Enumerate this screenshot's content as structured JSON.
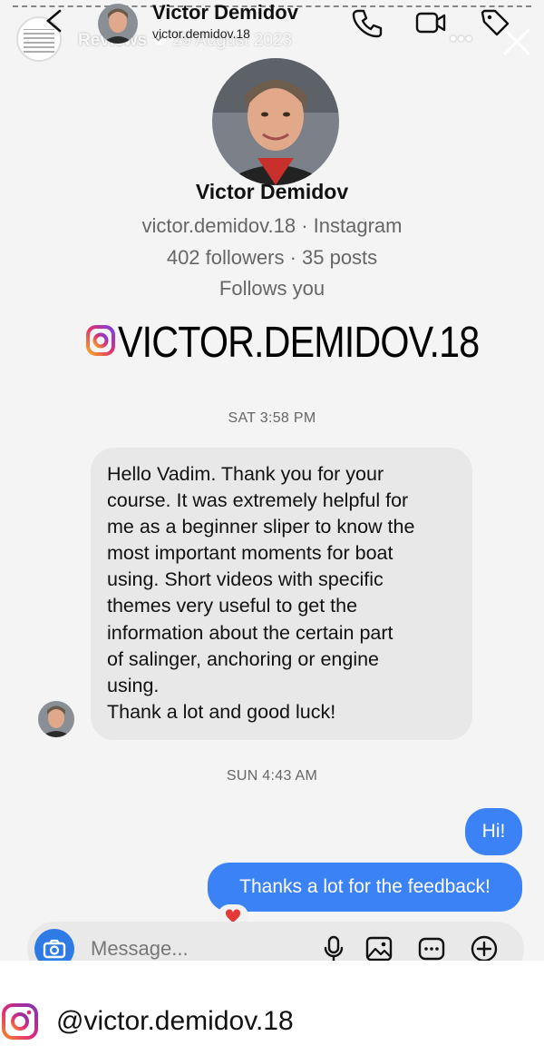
{
  "story": {
    "label": "Reviews",
    "date": "29 August 2023",
    "more": "•••"
  },
  "header": {
    "name": "Victor Demidov",
    "username": "victor.demidov.18"
  },
  "profile": {
    "name": "Victor Demidov",
    "handle_line": "victor.demidov.18 · Instagram",
    "stats_line": "402 followers · 35 posts",
    "follows_line": "Follows you"
  },
  "sticker": {
    "text": "VICTOR.DEMIDOV.18"
  },
  "thread": {
    "ts1": "SAT 3:58 PM",
    "incoming_lines": [
      "Hello Vadim. Thank you for your",
      "course. It was extremely helpful  for",
      "me as a beginner  sliper to know the",
      "most important  moments  for boat",
      "using.  Short videos with specific",
      "themes very useful  to get the",
      "information  about the certain part",
      "of salinger, anchoring  or engine",
      "using.",
      "Thank a lot and good luck!"
    ],
    "ts2": "SUN 4:43 AM",
    "out1": "Hi!",
    "out2": "Thanks a lot for the feedback!",
    "reaction": "heart"
  },
  "composer": {
    "placeholder": "Message..."
  },
  "caption": {
    "handle": "@victor.demidov.18"
  },
  "colors": {
    "bubble_out": "#3b82f6",
    "bubble_in": "#e8e8e8",
    "camera": "#2f7be5"
  }
}
